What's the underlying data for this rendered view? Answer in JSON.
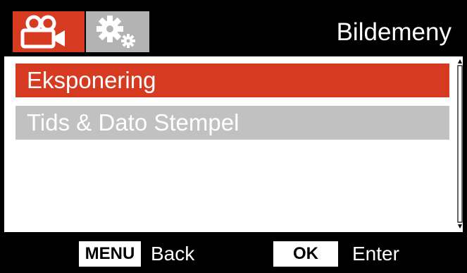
{
  "header": {
    "title": "Bildemeny",
    "tabs": [
      {
        "icon": "video-camera-icon",
        "active": true
      },
      {
        "icon": "gears-icon",
        "active": false
      }
    ]
  },
  "menu": {
    "items": [
      {
        "label": "Eksponering",
        "selected": true
      },
      {
        "label": "Tids & Dato Stempel",
        "selected": false
      }
    ]
  },
  "footer": {
    "menu_key": "MENU",
    "menu_action": "Back",
    "ok_key": "OK",
    "ok_action": "Enter"
  },
  "colors": {
    "accent": "#d63a21",
    "inactive_tab": "#b3b3b3",
    "inactive_item": "#c1c1c1",
    "background": "#000000",
    "panel": "#ffffff"
  }
}
